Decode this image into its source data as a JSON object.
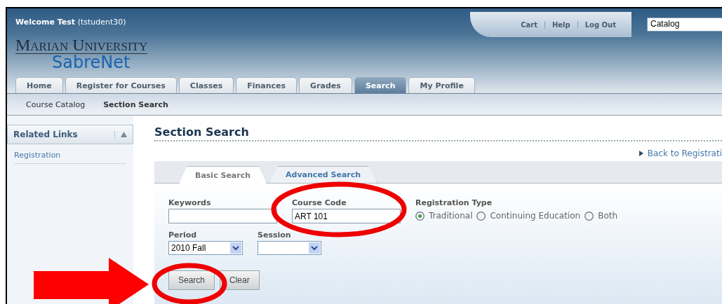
{
  "header": {
    "welcome_bold": "Welcome Test",
    "welcome_user": "(tstudent30)",
    "logo_top": "Marian University",
    "logo_bottom": "SabreNet",
    "links": [
      "Cart",
      "Help",
      "Log Out"
    ],
    "search_scope": "Catalog"
  },
  "tabs": [
    {
      "label": "Home",
      "selected": false
    },
    {
      "label": "Register for Courses",
      "selected": false
    },
    {
      "label": "Classes",
      "selected": false
    },
    {
      "label": "Finances",
      "selected": false
    },
    {
      "label": "Grades",
      "selected": false
    },
    {
      "label": "Search",
      "selected": true
    },
    {
      "label": "My Profile",
      "selected": false
    }
  ],
  "subnav": [
    {
      "label": "Course Catalog",
      "selected": false
    },
    {
      "label": "Section Search",
      "selected": true
    }
  ],
  "sidebar": {
    "title": "Related Links",
    "items": [
      "Registration"
    ]
  },
  "page_title": "Section Search",
  "back_link": "Back to Registrati",
  "search_tabs": [
    {
      "label": "Basic Search",
      "selected": true
    },
    {
      "label": "Advanced Search",
      "selected": false
    }
  ],
  "form": {
    "keywords": {
      "label": "Keywords"
    },
    "course_code": {
      "label": "Course Code",
      "value": "ART 101"
    },
    "registration_type": {
      "label": "Registration Type",
      "options": [
        {
          "label": "Traditional",
          "selected": true
        },
        {
          "label": "Continuing Education",
          "selected": false
        },
        {
          "label": "Both",
          "selected": false
        }
      ]
    },
    "period": {
      "label": "Period",
      "value": "2010 Fall"
    },
    "session": {
      "label": "Session"
    },
    "buttons": [
      "Search",
      "Clear"
    ]
  }
}
